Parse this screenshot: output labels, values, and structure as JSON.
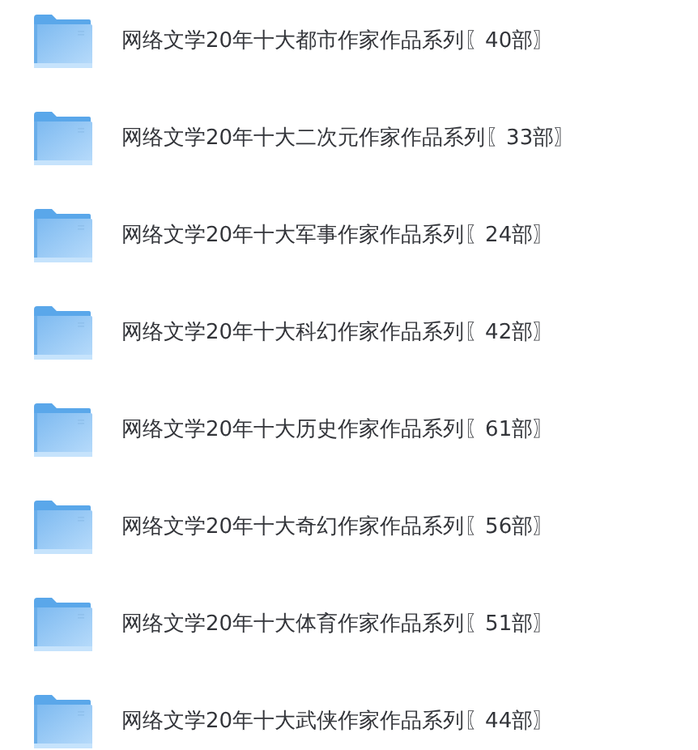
{
  "folders": [
    {
      "name": "网络文学20年十大都市作家作品系列〖40部〗"
    },
    {
      "name": "网络文学20年十大二次元作家作品系列〖33部〗"
    },
    {
      "name": "网络文学20年十大军事作家作品系列〖24部〗"
    },
    {
      "name": "网络文学20年十大科幻作家作品系列〖42部〗"
    },
    {
      "name": "网络文学20年十大历史作家作品系列〖61部〗"
    },
    {
      "name": "网络文学20年十大奇幻作家作品系列〖56部〗"
    },
    {
      "name": "网络文学20年十大体育作家作品系列〖51部〗"
    },
    {
      "name": "网络文学20年十大武侠作家作品系列〖44部〗"
    }
  ]
}
